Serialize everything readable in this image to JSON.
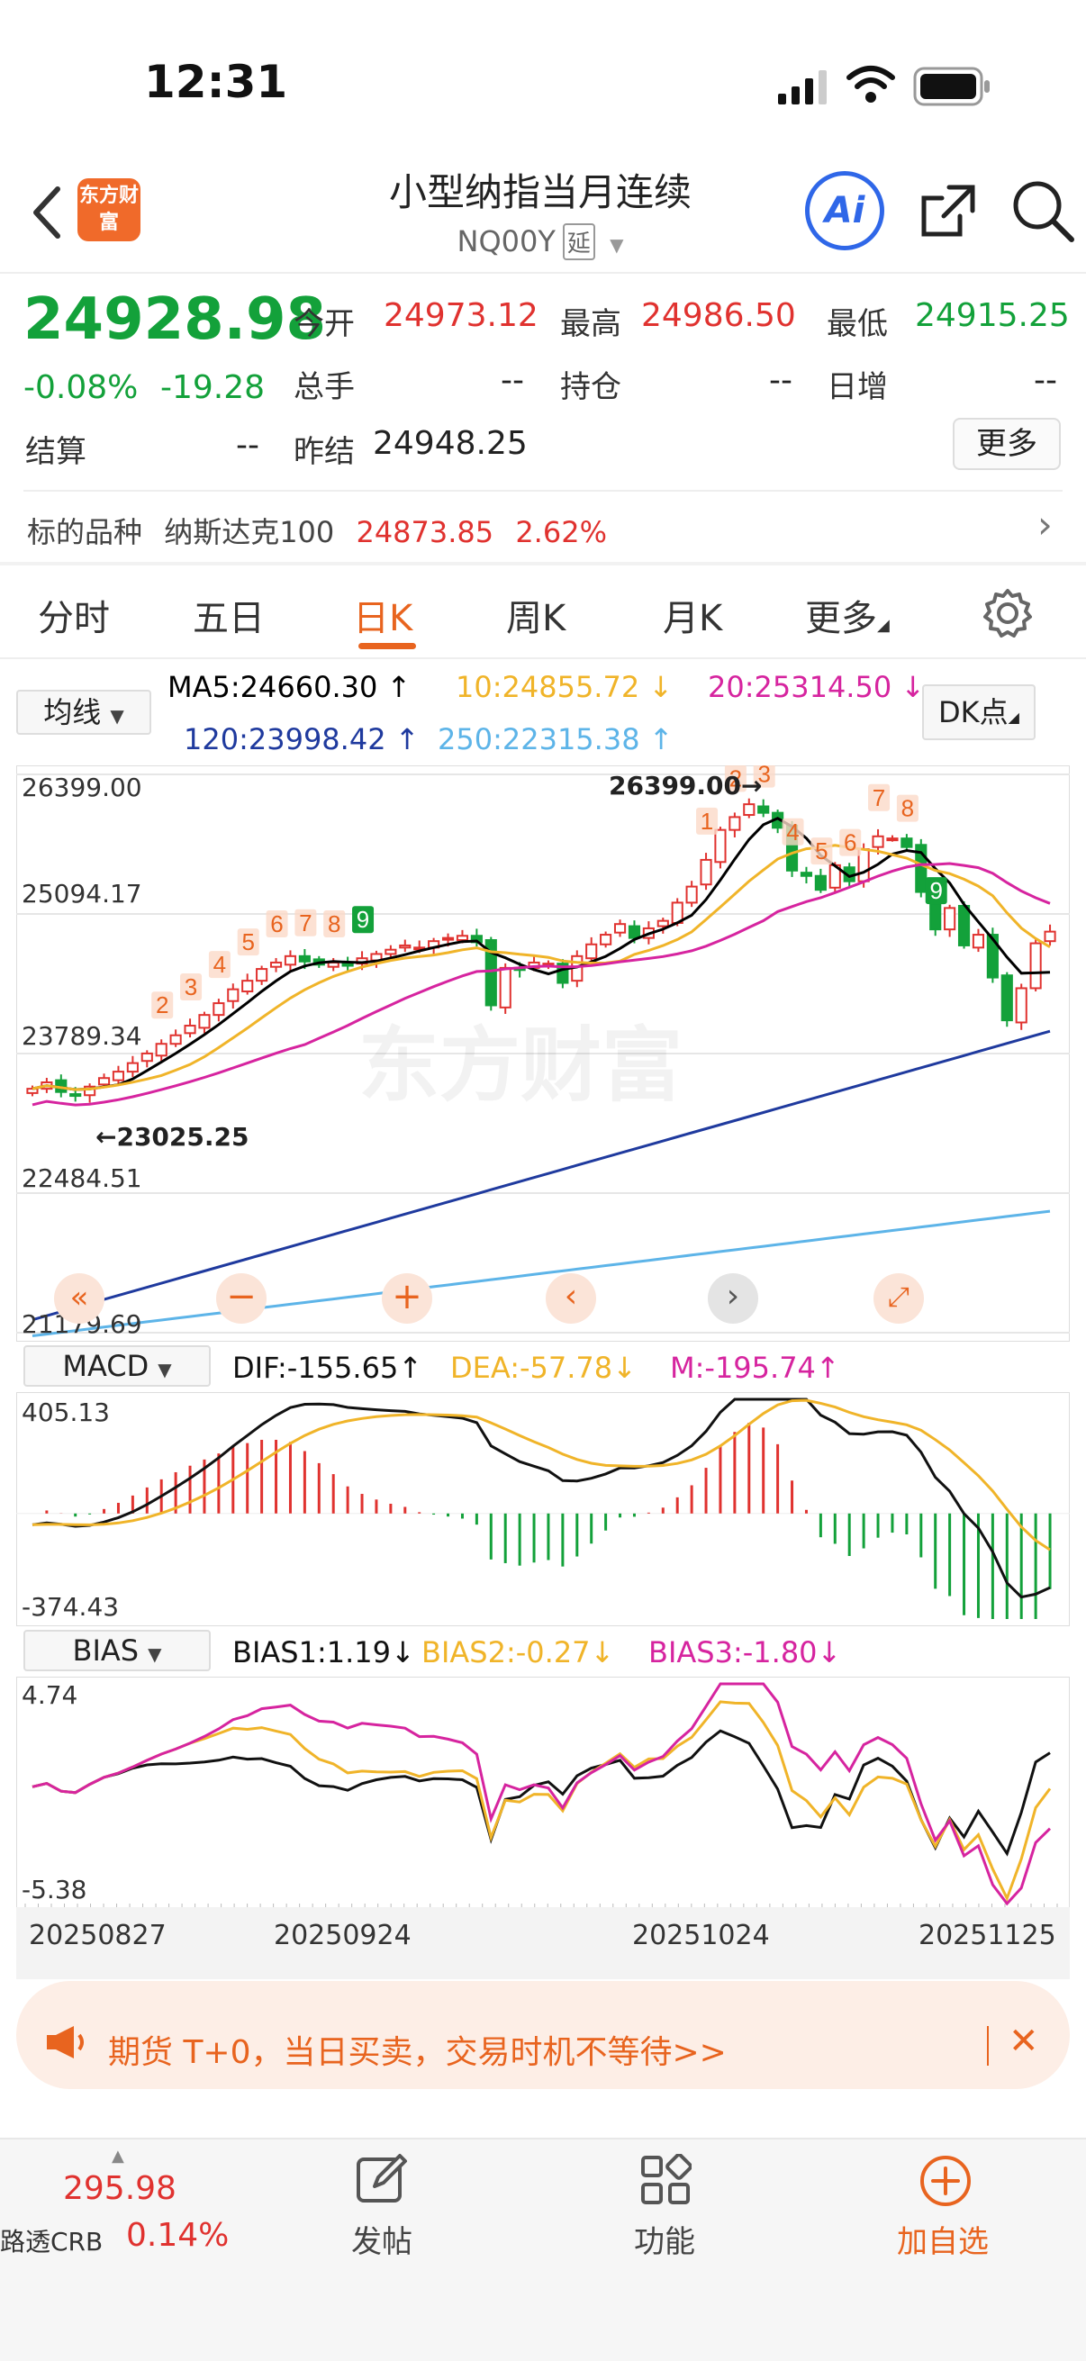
{
  "status_bar": {
    "time": "12:31"
  },
  "header": {
    "logo_text": "东方财富",
    "title": "小型纳指当月连续",
    "code": "NQ00Y",
    "delay_tag": "延",
    "ai_label": "Ai"
  },
  "quote": {
    "price": "24928.98",
    "change_pct": "-0.08%",
    "change": "-19.28",
    "open_label": "今开",
    "open": "24973.12",
    "high_label": "最高",
    "high": "24986.50",
    "low_label": "最低",
    "low": "24915.25",
    "volume_label": "总手",
    "volume": "--",
    "oi_label": "持仓",
    "oi": "--",
    "daily_inc_label": "日增",
    "daily_inc": "--",
    "settle_label": "结算",
    "settle": "--",
    "prev_settle_label": "昨结",
    "prev_settle": "24948.25",
    "more_label": "更多"
  },
  "underlying": {
    "label": "标的品种",
    "name": "纳斯达克100",
    "price": "24873.85",
    "pct": "2.62%"
  },
  "tabs": [
    "分时",
    "五日",
    "日K",
    "周K",
    "月K",
    "更多"
  ],
  "active_tab": "日K",
  "controls": {
    "ma_select": "均线",
    "dk_label": "DK点"
  },
  "ma": {
    "ma5": "MA5:24660.30",
    "ma10": "10:24855.72",
    "ma20": "20:25314.50",
    "ma120": "120:23998.42",
    "ma250": "250:22315.38"
  },
  "colors": {
    "up": "#e0322f",
    "down": "#13a13a",
    "accent": "#e8641f",
    "ma5": "#000000",
    "ma10": "#f0b429",
    "ma20": "#d6249f",
    "ma120": "#1f3a9e",
    "ma250": "#5db4e8"
  },
  "main_axis": {
    "y1": "26399.00",
    "y2": "25094.17",
    "y3": "23789.34",
    "y4": "22484.51",
    "y5": "21179.69",
    "high_note": "26399.00",
    "low_note": "23025.25",
    "watermark": "东方财富"
  },
  "seq_labels": [
    "2",
    "3",
    "4",
    "5",
    "6",
    "7",
    "8",
    "9",
    "1",
    "2",
    "3",
    "4",
    "5",
    "6",
    "7",
    "8",
    "9"
  ],
  "macd": {
    "select": "MACD",
    "dif": "DIF:-155.65",
    "dea": "DEA:-57.78",
    "m": "M:-195.74",
    "ymax": "405.13",
    "ymin": "-374.43"
  },
  "bias": {
    "select": "BIAS",
    "b1": "BIAS1:1.19",
    "b2": "BIAS2:-0.27",
    "b3": "BIAS3:-1.80",
    "ymax": "4.74",
    "ymin": "-5.38"
  },
  "x_axis": [
    "20250827",
    "20250924",
    "20251024",
    "20251125"
  ],
  "promo": {
    "text": "期货 T+0，当日买卖，交易时机不等待>>"
  },
  "bottom": {
    "ticker_price": "295.98",
    "ticker_name": "路透CRB",
    "ticker_pct": "0.14%",
    "post": "发帖",
    "func": "功能",
    "add": "加自选"
  },
  "chart_data": {
    "type": "candlestick",
    "title": "小型纳指当月连续 日K",
    "x_range": [
      "20250827",
      "20251125"
    ],
    "ylim": [
      21179.69,
      26399.0
    ],
    "series": [
      {
        "name": "MA5",
        "last": 24660.3
      },
      {
        "name": "10",
        "last": 24855.72
      },
      {
        "name": "20",
        "last": 25314.5
      },
      {
        "name": "120",
        "last": 23998.42
      },
      {
        "name": "250",
        "last": 22315.38
      }
    ],
    "annotations": {
      "high": 26399.0,
      "low": 23025.25
    },
    "close": [
      23460,
      23520,
      23430,
      23400,
      23480,
      23560,
      23620,
      23700,
      23790,
      23880,
      23960,
      24050,
      24150,
      24260,
      24390,
      24470,
      24580,
      24640,
      24700,
      24650,
      24620,
      24640,
      24610,
      24680,
      24720,
      24760,
      24800,
      24780,
      24840,
      24870,
      24890,
      24830,
      24240,
      24590,
      24570,
      24640,
      24630,
      24450,
      24700,
      24810,
      24900,
      25000,
      24870,
      24960,
      25030,
      25200,
      25350,
      25600,
      25880,
      26000,
      26120,
      26040,
      25900,
      25500,
      25450,
      25320,
      25550,
      25400,
      25700,
      25820,
      25800,
      25720,
      25300,
      24950,
      25150,
      24800,
      24900,
      24500,
      24100,
      24400,
      24820,
      24928.98
    ]
  }
}
